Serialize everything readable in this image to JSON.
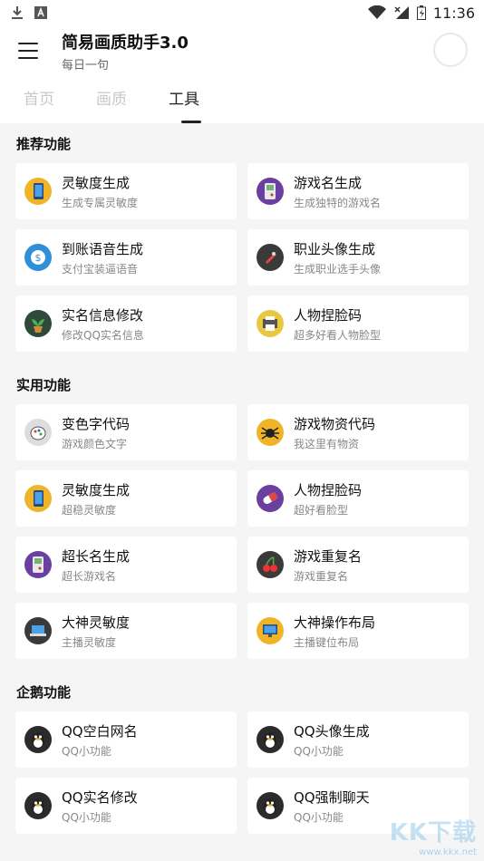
{
  "status_bar": {
    "time": "11:36"
  },
  "app_bar": {
    "title": "简易画质助手3.0",
    "subtitle": "每日一句"
  },
  "tabs": [
    {
      "label": "首页",
      "active": false
    },
    {
      "label": "画质",
      "active": false
    },
    {
      "label": "工具",
      "active": true
    }
  ],
  "sections": [
    {
      "title": "推荐功能",
      "items": [
        {
          "title": "灵敏度生成",
          "desc": "生成专属灵敏度",
          "icon": "phone-icon",
          "color": "#f0b429"
        },
        {
          "title": "游戏名生成",
          "desc": "生成独特的游戏名",
          "icon": "gameboy-icon",
          "color": "#6b3fa0"
        },
        {
          "title": "到账语音生成",
          "desc": "支付宝装逼语音",
          "icon": "money-icon",
          "color": "#2f8fd8"
        },
        {
          "title": "职业头像生成",
          "desc": "生成职业选手头像",
          "icon": "rocket-icon",
          "color": "#3a3a3a"
        },
        {
          "title": "实名信息修改",
          "desc": "修改QQ实名信息",
          "icon": "plant-icon",
          "color": "#2e4a3a"
        },
        {
          "title": "人物捏脸码",
          "desc": "超多好看人物脸型",
          "icon": "printer-icon",
          "color": "#e8c840"
        }
      ]
    },
    {
      "title": "实用功能",
      "items": [
        {
          "title": "变色字代码",
          "desc": "游戏颜色文字",
          "icon": "paint-icon",
          "color": "#dddddd"
        },
        {
          "title": "游戏物资代码",
          "desc": "我这里有物资",
          "icon": "spider-icon",
          "color": "#f0b429"
        },
        {
          "title": "灵敏度生成",
          "desc": "超稳灵敏度",
          "icon": "phone-icon",
          "color": "#f0b429"
        },
        {
          "title": "人物捏脸码",
          "desc": "超好看脸型",
          "icon": "pill-icon",
          "color": "#6b3fa0"
        },
        {
          "title": "超长名生成",
          "desc": "超长游戏名",
          "icon": "gameboy-icon",
          "color": "#6b3fa0"
        },
        {
          "title": "游戏重复名",
          "desc": "游戏重复名",
          "icon": "cherry-icon",
          "color": "#3a3a3a"
        },
        {
          "title": "大神灵敏度",
          "desc": "主播灵敏度",
          "icon": "laptop-icon",
          "color": "#3a3a3a"
        },
        {
          "title": "大神操作布局",
          "desc": "主播键位布局",
          "icon": "monitor-icon",
          "color": "#f0b429"
        }
      ]
    },
    {
      "title": "企鹅功能",
      "items": [
        {
          "title": "QQ空白网名",
          "desc": "QQ小功能",
          "icon": "penguin-icon",
          "color": "#2b2b2b"
        },
        {
          "title": "QQ头像生成",
          "desc": "QQ小功能",
          "icon": "penguin-icon",
          "color": "#2b2b2b"
        },
        {
          "title": "QQ实名修改",
          "desc": "QQ小功能",
          "icon": "penguin-icon",
          "color": "#2b2b2b"
        },
        {
          "title": "QQ强制聊天",
          "desc": "QQ小功能",
          "icon": "penguin-icon",
          "color": "#2b2b2b"
        }
      ]
    }
  ],
  "watermark": {
    "logo": "KK下载",
    "url": "www.kkx.net"
  }
}
